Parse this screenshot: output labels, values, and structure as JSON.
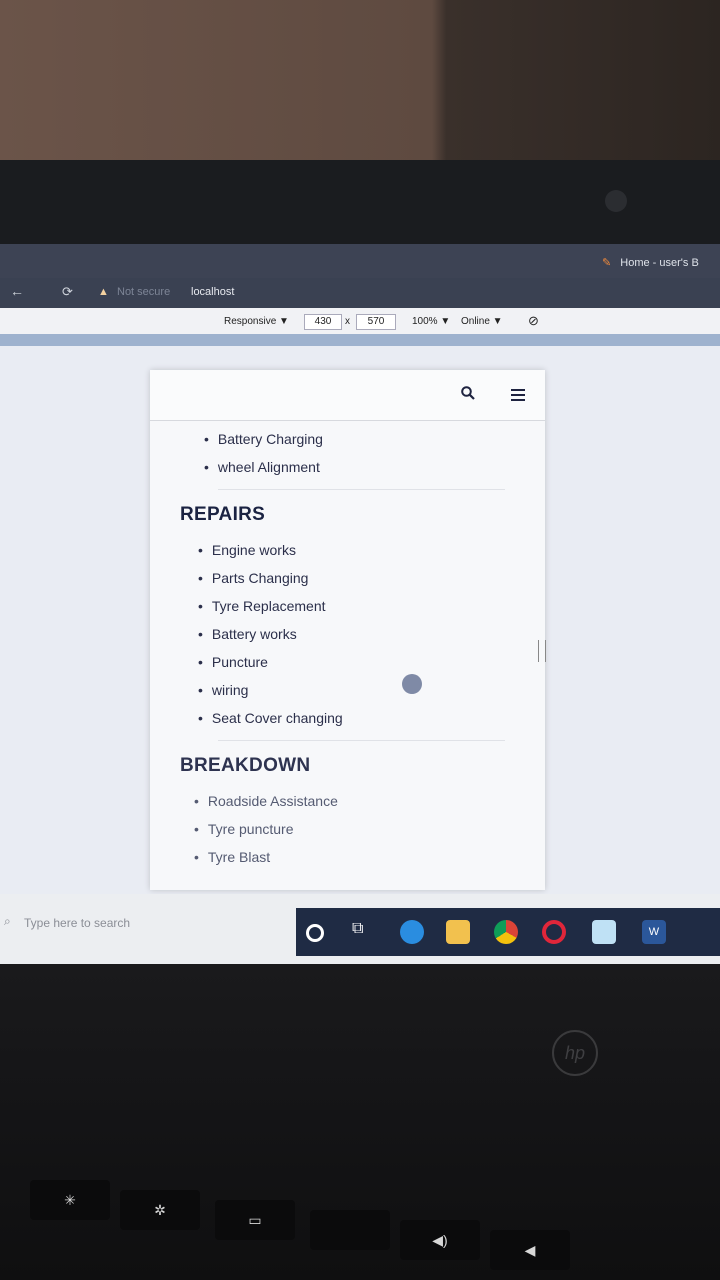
{
  "browser": {
    "tab_title": "Home - user's B",
    "security_label": "Not secure",
    "url": "localhost"
  },
  "devtools": {
    "device": "Responsive ▼",
    "width": "430",
    "times": "x",
    "height": "570",
    "zoom": "100% ▼",
    "network": "Online ▼"
  },
  "page": {
    "top_list": [
      "Battery Charging",
      "wheel Alignment"
    ],
    "repairs": {
      "heading": "REPAIRS",
      "items": [
        "Engine works",
        "Parts Changing",
        "Tyre Replacement",
        "Battery works",
        "Puncture",
        "wiring",
        "Seat Cover changing"
      ]
    },
    "breakdown": {
      "heading": "BREAKDOWN",
      "items": [
        "Roadside Assistance",
        "Tyre puncture",
        "Tyre Blast"
      ]
    }
  },
  "taskbar": {
    "search_placeholder": "Type here to search",
    "icons": [
      "cortana-icon",
      "task-view-icon",
      "edge-icon",
      "file-explorer-icon",
      "chrome-icon",
      "opera-icon",
      "app-icon",
      "word-icon"
    ]
  },
  "laptop": {
    "brand": "hp"
  }
}
